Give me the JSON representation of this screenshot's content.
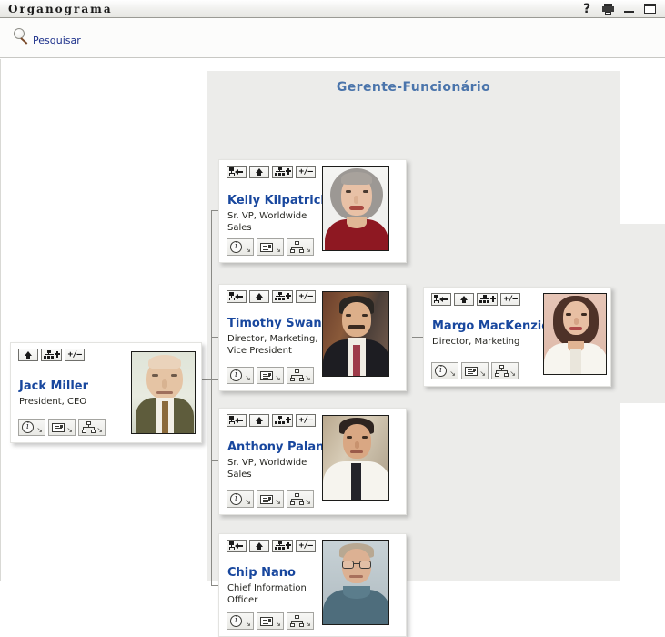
{
  "window": {
    "title": "Organograma",
    "buttons": [
      {
        "name": "help-icon",
        "label": "?"
      },
      {
        "name": "print-icon",
        "label": ""
      },
      {
        "name": "minimize-icon",
        "label": ""
      },
      {
        "name": "maximize-icon",
        "label": ""
      }
    ]
  },
  "toolbar": {
    "search": {
      "icon": "search-icon",
      "label": "Pesquisar"
    }
  },
  "colors": {
    "panel_bg": "#ececea",
    "panel_title": "#4a74ab",
    "person_name": "#18479e",
    "link": "#1b2f8a",
    "card_bg": "#ffffff",
    "canvas_bg": "#ffffff"
  },
  "panels": [
    {
      "name": "manager-employee-panel",
      "title": "Gerente-Funcionário"
    },
    {
      "name": "branch-panel",
      "title": ""
    }
  ],
  "card_buttons": {
    "top": {
      "goto_manager": {
        "icon": "node-back-icon",
        "label": ""
      },
      "move_up": {
        "icon": "up-arrow-icon",
        "label": ""
      },
      "add_chart": {
        "icon": "chart-plus-icon",
        "label": ""
      },
      "expand_collapse": {
        "icon": "plus-minus-icon",
        "label": "+/–"
      }
    },
    "bottom": {
      "info": {
        "icon": "info-icon",
        "label": ""
      },
      "details": {
        "icon": "business-card-icon",
        "label": ""
      },
      "hierarchy": {
        "icon": "hierarchy-icon",
        "label": ""
      }
    },
    "dropdown_caret": "↘"
  },
  "people": {
    "jack": {
      "name": "Jack Miller",
      "title": "President, CEO",
      "photo_alt": "jack-miller-photo",
      "has_goto_manager": false
    },
    "kelly": {
      "name": "Kelly Kilpatrick",
      "title": "Sr. VP, Worldwide Sales",
      "photo_alt": "kelly-kilpatrick-photo",
      "has_goto_manager": true
    },
    "tim": {
      "name": "Timothy Swan",
      "title": "Director, Marketing, Vice President",
      "photo_alt": "timothy-swan-photo",
      "has_goto_manager": true
    },
    "anthony": {
      "name": "Anthony Palani",
      "title": "Sr. VP, Worldwide Sales",
      "photo_alt": "anthony-palani-photo",
      "has_goto_manager": true
    },
    "chip": {
      "name": "Chip Nano",
      "title": "Chief Information Officer",
      "photo_alt": "chip-nano-photo",
      "has_goto_manager": true
    },
    "margo": {
      "name": "Margo MacKenzie",
      "title": "Director, Marketing",
      "photo_alt": "margo-mackenzie-photo",
      "has_goto_manager": true
    }
  }
}
